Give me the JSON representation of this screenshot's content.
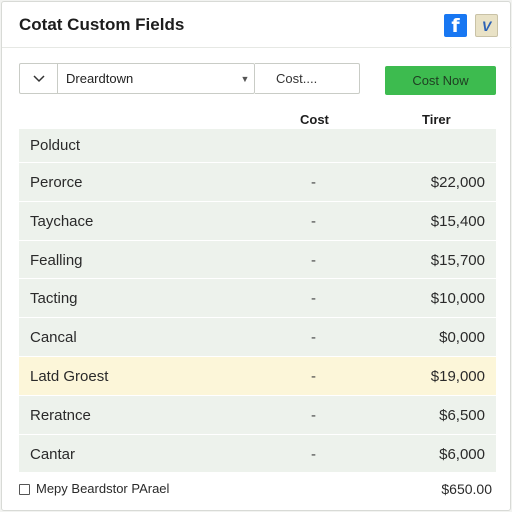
{
  "header": {
    "title": "Cotat Custom Fields",
    "icons": [
      {
        "name": "facebook-icon",
        "glyph": "f",
        "color": "#1877f2"
      },
      {
        "name": "brand-icon",
        "glyph": "V",
        "color": "#2d62b5"
      }
    ]
  },
  "toolbar": {
    "dropdown_value": "Dreardtown",
    "cost_placeholder": "Cost....",
    "button_label": "Cost Now",
    "button_color": "#3dbb4f"
  },
  "table": {
    "columns": [
      "Cost",
      "Tirer"
    ],
    "header_row": "Polduct",
    "rows": [
      {
        "name": "Perorce",
        "cost": "-",
        "price": "$22,000"
      },
      {
        "name": "Taychace",
        "cost": "-",
        "price": "$15,400"
      },
      {
        "name": "Fealling",
        "cost": "-",
        "price": "$15,700"
      },
      {
        "name": "Tacting",
        "cost": "-",
        "price": "$10,000"
      },
      {
        "name": "Cancal",
        "cost": "-",
        "price": "$0,000"
      },
      {
        "name": "Latd Groest",
        "cost": "-",
        "price": "$19,000",
        "highlight": true
      },
      {
        "name": "Reratnce",
        "cost": "-",
        "price": "$6,500"
      },
      {
        "name": "Cantar",
        "cost": "-",
        "price": "$6,000"
      }
    ]
  },
  "footer": {
    "checkbox_label": "Mepy Beardstor PArael",
    "total": "$650.00"
  }
}
